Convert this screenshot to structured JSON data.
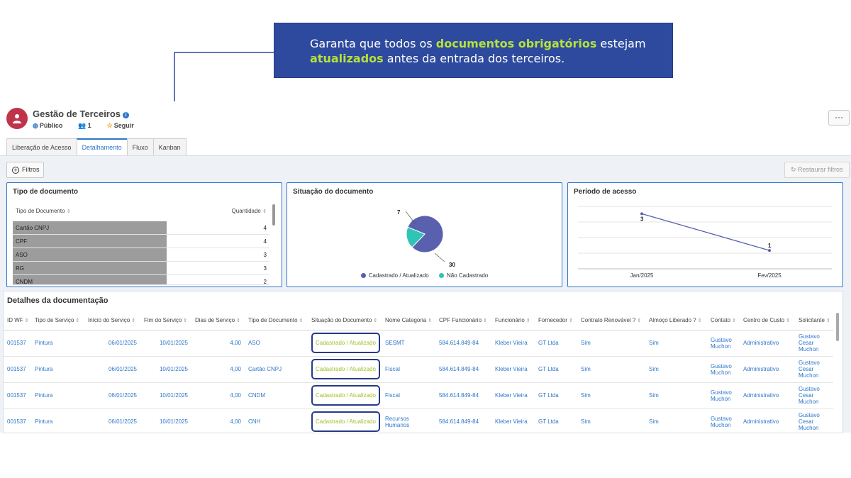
{
  "callout": {
    "part1": "Garanta que todos os ",
    "highlight1": "documentos obrigatórios",
    "part2": " estejam",
    "highlight2": "atualizados",
    "part3": " antes da entrada dos terceiros."
  },
  "header": {
    "title": "Gestão de Terceiros",
    "visibility": "Público",
    "members": "1",
    "follow": "Seguir",
    "more": "···"
  },
  "tabs": [
    "Liberação de Acesso",
    "Detalhamento",
    "Fluxo",
    "Kanban"
  ],
  "toolbar": {
    "filters": "Filtros",
    "restore": "Restaurar filtros"
  },
  "doc_type_card": {
    "title": "Tipo de documento",
    "col1": "Tipo de Documento",
    "col2": "Quantidade",
    "rows": [
      {
        "label": "Cartão CNPJ",
        "value": "4"
      },
      {
        "label": "CPF",
        "value": "4"
      },
      {
        "label": "ASO",
        "value": "3"
      },
      {
        "label": "RG",
        "value": "3"
      },
      {
        "label": "CNDM",
        "value": "2"
      }
    ]
  },
  "status_card": {
    "title": "Situação do documento",
    "legend1": "Cadastrado / Atualizado",
    "legend2": "Não Cadastrado",
    "label1": "30",
    "label2": "7"
  },
  "period_card": {
    "title": "Período de acesso",
    "label1": "3",
    "label2": "1",
    "x1": "Jan/2025",
    "x2": "Fev/2025"
  },
  "chart_data": [
    {
      "type": "table",
      "title": "Tipo de documento",
      "columns": [
        "Tipo de Documento",
        "Quantidade"
      ],
      "rows": [
        [
          "Cartão CNPJ",
          4
        ],
        [
          "CPF",
          4
        ],
        [
          "ASO",
          3
        ],
        [
          "RG",
          3
        ],
        [
          "CNDM",
          2
        ]
      ]
    },
    {
      "type": "pie",
      "title": "Situação do documento",
      "categories": [
        "Cadastrado / Atualizado",
        "Não Cadastrado"
      ],
      "values": [
        30,
        7
      ],
      "colors": [
        "#5960ad",
        "#2ec4b6"
      ],
      "legend": "bottom"
    },
    {
      "type": "line",
      "title": "Período de acesso",
      "categories": [
        "Jan/2025",
        "Fev/2025"
      ],
      "values": [
        3,
        1
      ],
      "colors": [
        "#5960ad"
      ],
      "grid": true
    }
  ],
  "details": {
    "title": "Detalhes da documentação",
    "columns": [
      "ID WF",
      "Tipo de Serviço",
      "Início do Serviço",
      "Fim do Serviço",
      "Dias de Serviço",
      "Tipo de Documento",
      "Situação do Documento",
      "Nome Categoria",
      "CPF Funcionário",
      "Funcionário",
      "Fornecedor",
      "Contrato Renovável ?",
      "Almoço Liberado ?",
      "Contato",
      "Centro de Custo",
      "Solicitante"
    ],
    "rows": [
      [
        "001537",
        "Pintura",
        "06/01/2025",
        "10/01/2025",
        "4,00",
        "ASO",
        "Cadastrado / Atualizado",
        "SESMT",
        "584.614.849-84",
        "Kleber Vieira",
        "GT Ltda",
        "Sim",
        "Sim",
        "Gustavo Muchon",
        "Administrativo",
        "Gustavo Cesar Muchon"
      ],
      [
        "001537",
        "Pintura",
        "06/01/2025",
        "10/01/2025",
        "4,00",
        "Cartão CNPJ",
        "Cadastrado / Atualizado",
        "Fiscal",
        "584.614.849-84",
        "Kleber Vieira",
        "GT Ltda",
        "Sim",
        "Sim",
        "Gustavo Muchon",
        "Administrativo",
        "Gustavo Cesar Muchon"
      ],
      [
        "001537",
        "Pintura",
        "06/01/2025",
        "10/01/2025",
        "4,00",
        "CNDM",
        "Cadastrado / Atualizado",
        "Fiscal",
        "584.614.849-84",
        "Kleber Vieira",
        "GT Ltda",
        "Sim",
        "Sim",
        "Gustavo Muchon",
        "Administrativo",
        "Gustavo Cesar Muchon"
      ],
      [
        "001537",
        "Pintura",
        "06/01/2025",
        "10/01/2025",
        "4,00",
        "CNH",
        "Cadastrado / Atualizado",
        "Recursos Humanos",
        "584.614.849-84",
        "Kleber Vieira",
        "GT Ltda",
        "Sim",
        "Sim",
        "Gustavo Muchon",
        "Administrativo",
        "Gustavo Cesar Muchon"
      ]
    ]
  }
}
